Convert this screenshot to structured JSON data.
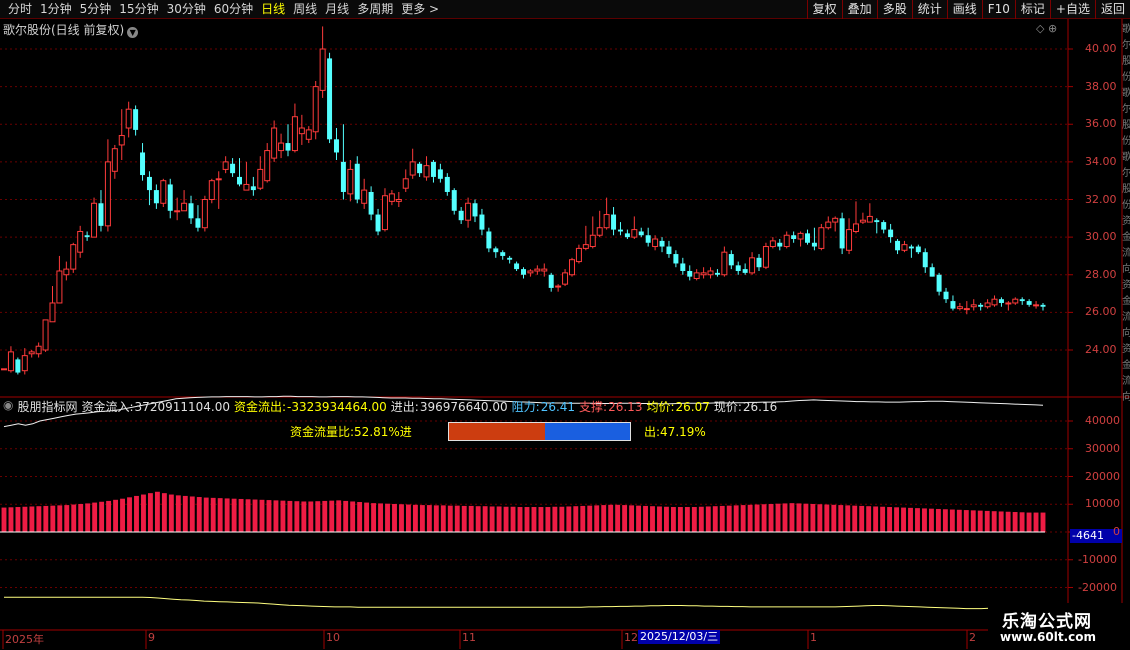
{
  "toolbar": {
    "periods": [
      "分时",
      "1分钟",
      "5分钟",
      "15分钟",
      "30分钟",
      "60分钟",
      "日线",
      "周线",
      "月线",
      "多周期",
      "更多 >"
    ],
    "active_period": "日线",
    "tools": [
      "复权",
      "叠加",
      "多股",
      "统计",
      "画线",
      "F10",
      "标记",
      "+自选",
      "返回"
    ]
  },
  "main_panel": {
    "title": "歌尔股份(日线 前复权)",
    "y_ticks": [
      "40.00",
      "38.00",
      "36.00",
      "34.00",
      "32.00",
      "30.00",
      "28.00",
      "26.00",
      "24.00"
    ]
  },
  "indicator_panel": {
    "name": "股朋指标网",
    "fields": [
      {
        "label": "资金流入:",
        "value": "3720911104.00",
        "color": "white"
      },
      {
        "label": "资金流出:",
        "value": "-3323934464.00",
        "color": "yellow"
      },
      {
        "label": "进出:",
        "value": "396976640.00",
        "color": "white"
      },
      {
        "label": "阻力:",
        "value": "26.41",
        "color": "cyan"
      },
      {
        "label": "支撑:",
        "value": "26.13",
        "color": "red"
      },
      {
        "label": "均价:",
        "value": "26.07",
        "color": "yellow"
      },
      {
        "label": "现价:",
        "value": "26.16",
        "color": "white"
      }
    ],
    "ratio_in_text": "资金流量比:52.81%进",
    "ratio_out_text": "出:47.19%",
    "ratio_in_pct": 52.81,
    "ratio_out_pct": 47.19,
    "y_ticks": [
      "40000",
      "30000",
      "20000",
      "10000",
      "0",
      "-10000",
      "-20000"
    ],
    "current_value": "-4641"
  },
  "x_axis": {
    "labels": [
      "2025年",
      "9",
      "10",
      "11",
      "12",
      "1",
      "2"
    ],
    "cursor_date": "2025/12/03/三"
  },
  "watermark": {
    "title": "乐淘公式网",
    "url": "www.60lt.com"
  },
  "right_strip_text": "歌尔股份歌尔股份歌尔股份资金流向资金流向资金流向技术指标",
  "colors": {
    "up": "#ff3b3b",
    "down": "#54ffff",
    "frame": "#a00000",
    "yellow_line": "#ffff80",
    "histogram": "#ee1c44"
  },
  "chart_data": {
    "type": "candlestick",
    "x": [
      "2025-08",
      "2025-09",
      "2025-10",
      "2025-11",
      "2025-12",
      "2026-01",
      "2026-02"
    ],
    "ylim": [
      22.6,
      41.2
    ],
    "candles": [
      [
        23.0,
        23.0,
        22.9,
        22.9
      ],
      [
        22.9,
        23.9,
        24.2,
        22.8
      ],
      [
        23.5,
        22.8,
        23.6,
        22.7
      ],
      [
        22.9,
        23.7,
        24.1,
        22.7
      ],
      [
        23.8,
        23.9,
        24.0,
        23.6
      ],
      [
        23.8,
        24.2,
        24.4,
        23.6
      ],
      [
        24.0,
        25.6,
        25.6,
        23.9
      ],
      [
        25.5,
        26.5,
        27.4,
        25.5
      ],
      [
        26.5,
        28.2,
        29.0,
        26.5
      ],
      [
        28.0,
        28.3,
        28.7,
        27.7
      ],
      [
        28.3,
        29.6,
        29.7,
        28.1
      ],
      [
        29.2,
        30.3,
        30.6,
        28.9
      ],
      [
        30.1,
        30.0,
        30.3,
        29.8
      ],
      [
        30.0,
        31.8,
        32.1,
        30.0
      ],
      [
        31.8,
        30.6,
        32.5,
        30.3
      ],
      [
        30.6,
        34.0,
        35.2,
        30.3
      ],
      [
        33.5,
        34.7,
        34.9,
        33.1
      ],
      [
        34.9,
        35.4,
        36.8,
        34.1
      ],
      [
        35.8,
        36.8,
        37.2,
        35.3
      ],
      [
        36.8,
        35.7,
        37.0,
        35.4
      ],
      [
        34.5,
        33.3,
        35.0,
        33.0
      ],
      [
        33.2,
        32.5,
        33.5,
        31.7
      ],
      [
        32.5,
        31.8,
        32.8,
        31.5
      ],
      [
        31.8,
        33.0,
        33.1,
        31.6
      ],
      [
        32.8,
        31.4,
        33.1,
        31.0
      ],
      [
        31.4,
        31.4,
        32.1,
        30.9
      ],
      [
        31.4,
        31.8,
        32.5,
        31.4
      ],
      [
        31.8,
        31.0,
        32.2,
        30.7
      ],
      [
        31.0,
        30.5,
        31.7,
        30.3
      ],
      [
        30.5,
        32.0,
        32.2,
        30.3
      ],
      [
        32.0,
        33.0,
        33.1,
        31.8
      ],
      [
        33.1,
        33.1,
        33.5,
        31.5
      ],
      [
        33.6,
        34.0,
        34.3,
        33.4
      ],
      [
        33.9,
        33.4,
        34.2,
        33.2
      ],
      [
        33.2,
        32.8,
        34.2,
        32.7
      ],
      [
        32.5,
        32.8,
        34.0,
        32.5
      ],
      [
        32.7,
        32.5,
        33.2,
        32.2
      ],
      [
        32.6,
        33.6,
        34.3,
        32.5
      ],
      [
        33.0,
        34.6,
        35.0,
        32.9
      ],
      [
        34.2,
        35.8,
        36.2,
        34.0
      ],
      [
        34.6,
        35.0,
        35.5,
        34.2
      ],
      [
        35.0,
        34.6,
        36.0,
        34.3
      ],
      [
        34.6,
        36.4,
        37.1,
        34.5
      ],
      [
        35.5,
        35.8,
        36.5,
        34.9
      ],
      [
        35.2,
        35.7,
        35.9,
        35.0
      ],
      [
        35.6,
        38.0,
        38.3,
        35.2
      ],
      [
        37.8,
        40.0,
        41.2,
        37.4
      ],
      [
        39.5,
        35.2,
        39.8,
        35.0
      ],
      [
        35.2,
        34.5,
        35.8,
        34.1
      ],
      [
        34.0,
        32.4,
        36.0,
        32.0
      ],
      [
        32.3,
        33.6,
        34.1,
        31.9
      ],
      [
        33.9,
        32.0,
        34.3,
        31.8
      ],
      [
        31.8,
        32.5,
        33.1,
        31.5
      ],
      [
        32.4,
        31.2,
        32.7,
        30.9
      ],
      [
        31.2,
        30.3,
        31.5,
        30.1
      ],
      [
        30.4,
        32.2,
        32.6,
        30.3
      ],
      [
        31.9,
        32.3,
        32.5,
        31.7
      ],
      [
        31.9,
        32.0,
        32.4,
        31.6
      ],
      [
        32.6,
        33.1,
        33.6,
        32.4
      ],
      [
        33.3,
        34.0,
        34.7,
        33.1
      ],
      [
        33.9,
        33.4,
        34.0,
        33.2
      ],
      [
        33.2,
        33.8,
        34.3,
        33.0
      ],
      [
        34.0,
        33.2,
        34.1,
        32.9
      ],
      [
        33.6,
        33.1,
        33.9,
        32.9
      ],
      [
        33.2,
        32.4,
        33.4,
        32.2
      ],
      [
        32.5,
        31.4,
        32.6,
        31.2
      ],
      [
        31.4,
        30.9,
        31.6,
        30.7
      ],
      [
        30.9,
        31.8,
        32.1,
        30.5
      ],
      [
        31.8,
        31.1,
        32.0,
        30.8
      ],
      [
        31.2,
        30.4,
        31.5,
        30.1
      ],
      [
        30.3,
        29.4,
        30.5,
        29.2
      ],
      [
        29.4,
        29.2,
        29.5,
        28.9
      ],
      [
        29.2,
        29.0,
        29.3,
        28.8
      ],
      [
        28.9,
        28.8,
        29.0,
        28.6
      ],
      [
        28.6,
        28.3,
        28.7,
        28.2
      ],
      [
        28.3,
        28.0,
        28.4,
        27.8
      ],
      [
        28.1,
        28.2,
        28.3,
        27.9
      ],
      [
        28.2,
        28.3,
        28.5,
        28.0
      ],
      [
        28.2,
        28.3,
        28.6,
        27.9
      ],
      [
        28.0,
        27.3,
        28.1,
        27.1
      ],
      [
        27.4,
        27.4,
        27.5,
        27.1
      ],
      [
        27.5,
        28.1,
        28.3,
        27.4
      ],
      [
        28.0,
        28.8,
        28.9,
        27.9
      ],
      [
        28.7,
        29.4,
        29.6,
        28.6
      ],
      [
        29.4,
        29.6,
        30.6,
        29.3
      ],
      [
        29.5,
        30.1,
        31.1,
        29.4
      ],
      [
        30.1,
        30.5,
        31.4,
        30.0
      ],
      [
        30.5,
        31.2,
        32.1,
        30.4
      ],
      [
        31.2,
        30.4,
        31.6,
        30.1
      ],
      [
        30.4,
        30.3,
        30.8,
        30.1
      ],
      [
        30.2,
        30.0,
        30.4,
        29.9
      ],
      [
        30.0,
        30.4,
        31.1,
        29.9
      ],
      [
        30.3,
        30.1,
        30.5,
        30.0
      ],
      [
        30.1,
        29.7,
        30.5,
        29.5
      ],
      [
        29.5,
        29.9,
        30.1,
        29.3
      ],
      [
        29.8,
        29.5,
        30.0,
        29.2
      ],
      [
        29.5,
        29.1,
        29.8,
        28.9
      ],
      [
        29.1,
        28.6,
        29.3,
        28.4
      ],
      [
        28.6,
        28.2,
        28.9,
        28.0
      ],
      [
        28.2,
        27.9,
        28.5,
        27.7
      ],
      [
        27.8,
        28.1,
        28.3,
        27.7
      ],
      [
        28.0,
        28.1,
        28.4,
        27.8
      ],
      [
        28.0,
        28.2,
        28.4,
        27.8
      ],
      [
        28.1,
        28.0,
        28.3,
        27.9
      ],
      [
        28.0,
        29.2,
        29.5,
        27.9
      ],
      [
        29.1,
        28.5,
        29.3,
        28.3
      ],
      [
        28.5,
        28.2,
        28.7,
        28.0
      ],
      [
        28.3,
        28.1,
        28.6,
        28.0
      ],
      [
        28.1,
        28.9,
        29.2,
        28.0
      ],
      [
        28.9,
        28.4,
        29.1,
        28.2
      ],
      [
        28.4,
        29.5,
        29.7,
        28.3
      ],
      [
        29.5,
        29.8,
        30.0,
        29.4
      ],
      [
        29.7,
        29.5,
        29.9,
        29.3
      ],
      [
        29.5,
        30.1,
        30.3,
        29.4
      ],
      [
        30.1,
        29.9,
        30.3,
        29.7
      ],
      [
        29.9,
        30.2,
        30.3,
        29.5
      ],
      [
        30.2,
        29.7,
        30.4,
        29.6
      ],
      [
        29.7,
        29.5,
        30.5,
        29.3
      ],
      [
        29.4,
        30.5,
        30.7,
        29.3
      ],
      [
        30.5,
        30.8,
        31.1,
        30.4
      ],
      [
        30.8,
        31.0,
        31.1,
        30.3
      ],
      [
        31.0,
        29.4,
        31.3,
        29.1
      ],
      [
        29.3,
        30.4,
        31.0,
        29.1
      ],
      [
        30.3,
        30.7,
        31.9,
        30.2
      ],
      [
        30.8,
        30.9,
        31.3,
        30.7
      ],
      [
        30.8,
        31.1,
        31.8,
        30.8
      ],
      [
        30.9,
        30.8,
        31.0,
        30.2
      ],
      [
        30.8,
        30.4,
        30.9,
        30.2
      ],
      [
        30.4,
        30.0,
        30.7,
        29.7
      ],
      [
        29.8,
        29.3,
        29.9,
        29.1
      ],
      [
        29.3,
        29.6,
        29.8,
        29.2
      ],
      [
        29.5,
        29.4,
        29.6,
        28.9
      ],
      [
        29.5,
        29.2,
        29.6,
        29.1
      ],
      [
        29.2,
        28.4,
        29.4,
        28.1
      ],
      [
        28.4,
        27.9,
        28.6,
        27.9
      ],
      [
        28.0,
        27.1,
        28.1,
        26.9
      ],
      [
        27.1,
        26.7,
        27.3,
        26.5
      ],
      [
        26.6,
        26.2,
        26.9,
        26.1
      ],
      [
        26.2,
        26.3,
        26.5,
        26.1
      ],
      [
        26.2,
        26.2,
        26.6,
        25.9
      ],
      [
        26.3,
        26.4,
        26.7,
        26.1
      ],
      [
        26.4,
        26.3,
        26.5,
        26.1
      ],
      [
        26.3,
        26.5,
        26.7,
        26.2
      ],
      [
        26.4,
        26.7,
        26.9,
        26.3
      ],
      [
        26.7,
        26.5,
        26.8,
        26.3
      ],
      [
        26.5,
        26.5,
        26.6,
        26.1
      ],
      [
        26.5,
        26.7,
        26.8,
        26.4
      ],
      [
        26.7,
        26.6,
        26.8,
        26.4
      ],
      [
        26.6,
        26.4,
        26.7,
        26.3
      ],
      [
        26.4,
        26.4,
        26.6,
        26.2
      ],
      [
        26.4,
        26.3,
        26.5,
        26.1
      ]
    ],
    "indicator": {
      "white_line": [
        38000,
        38500,
        39000,
        38500,
        39000,
        40000,
        40500,
        41000,
        41500,
        42000,
        42500,
        42700,
        43000,
        43300,
        43500,
        43700,
        44000,
        44500,
        45000,
        45500,
        46000,
        46500,
        47000,
        47500,
        48000,
        48200,
        48400,
        48500,
        48600,
        48700,
        48700,
        48800,
        48800,
        48800,
        48800,
        48700,
        48700,
        48800,
        48800,
        48900,
        48900,
        48800,
        48800,
        48800,
        48700,
        48700,
        48800,
        48800,
        48800,
        48700,
        48700,
        48600,
        48500,
        48400,
        48300,
        48300,
        48300,
        48200,
        48200,
        48100,
        48000,
        48000,
        47900,
        47800,
        47700,
        47600,
        47500,
        47400,
        47300,
        47200,
        47100,
        47000,
        46900,
        46800,
        46700,
        46600,
        46500,
        46500,
        46500,
        46400,
        46400,
        46400,
        46400,
        46300,
        46300,
        46300,
        46400,
        46400,
        46400,
        46300,
        46300,
        46200,
        46200,
        46200,
        46300,
        46400,
        46400,
        46400,
        46400,
        46500,
        46500,
        46500,
        46600,
        46600,
        46700,
        46700,
        46800,
        46800,
        46900,
        47000,
        47200,
        47400,
        47500,
        47600,
        47500,
        47400,
        47300,
        47200,
        47100,
        47000,
        47000,
        46900,
        46900,
        46800,
        46800,
        46800,
        46900,
        47000,
        47000,
        47100,
        47100,
        47100,
        47000,
        46900,
        46800,
        46700,
        46600,
        46500,
        46400,
        46300,
        46200,
        46100,
        46000,
        45900,
        45800,
        45700
      ],
      "histogram": [
        8800,
        8900,
        9000,
        9100,
        9200,
        9300,
        9400,
        9500,
        9600,
        9700,
        9900,
        10100,
        10300,
        10600,
        10900,
        11200,
        11600,
        12000,
        12500,
        13000,
        13500,
        14000,
        14500,
        14000,
        13500,
        13200,
        13000,
        12800,
        12600,
        12400,
        12300,
        12200,
        12100,
        12000,
        11900,
        11800,
        11700,
        11600,
        11500,
        11400,
        11300,
        11200,
        11100,
        11000,
        11000,
        11100,
        11200,
        11300,
        11400,
        11200,
        11000,
        10800,
        10600,
        10400,
        10300,
        10200,
        10100,
        10000,
        9900,
        9800,
        9700,
        9700,
        9600,
        9600,
        9500,
        9500,
        9400,
        9400,
        9300,
        9300,
        9200,
        9200,
        9100,
        9100,
        9000,
        9000,
        9000,
        9000,
        9000,
        9100,
        9100,
        9200,
        9300,
        9400,
        9500,
        9600,
        9700,
        9800,
        9800,
        9700,
        9600,
        9500,
        9400,
        9300,
        9200,
        9100,
        9000,
        9000,
        9000,
        9000,
        9100,
        9200,
        9300,
        9400,
        9500,
        9600,
        9700,
        9800,
        9900,
        10000,
        10100,
        10200,
        10300,
        10400,
        10300,
        10200,
        10100,
        10000,
        9900,
        9800,
        9700,
        9600,
        9500,
        9400,
        9300,
        9200,
        9100,
        9000,
        8900,
        8800,
        8700,
        8600,
        8500,
        8400,
        8300,
        8200,
        8100,
        8000,
        7900,
        7800,
        7700,
        7600,
        7500,
        7400,
        7300,
        7200,
        7100,
        7000,
        7000,
        7000
      ],
      "yellow_line": [
        -23500,
        -23500,
        -23500,
        -23500,
        -23500,
        -23500,
        -23500,
        -23500,
        -23500,
        -23500,
        -23500,
        -23500,
        -23500,
        -23500,
        -23500,
        -23500,
        -23500,
        -23500,
        -23500,
        -23600,
        -23800,
        -24000,
        -24200,
        -24400,
        -24500,
        -24700,
        -24900,
        -25000,
        -25100,
        -25200,
        -25300,
        -25400,
        -25500,
        -25600,
        -25800,
        -26000,
        -26200,
        -26400,
        -26500,
        -26600,
        -26700,
        -26800,
        -26900,
        -27000,
        -27000,
        -27000,
        -27100,
        -27100,
        -27100,
        -27100,
        -27100,
        -27100,
        -27100,
        -27100,
        -27100,
        -27100,
        -27100,
        -27100,
        -27100,
        -27100,
        -27100,
        -27100,
        -27100,
        -27100,
        -27100,
        -27100,
        -27100,
        -27100,
        -27100,
        -27100,
        -27100,
        -27100,
        -27100,
        -27100,
        -27100,
        -27100,
        -27000,
        -27000,
        -26900,
        -26900,
        -26800,
        -26800,
        -26700,
        -26700,
        -26600,
        -26600,
        -26500,
        -26500,
        -26500,
        -26600,
        -26600,
        -26700,
        -26700,
        -26800,
        -26800,
        -26900,
        -26900,
        -27000,
        -27000,
        -27000,
        -27000,
        -27000,
        -27000,
        -27000,
        -27000,
        -27000,
        -27000,
        -27000,
        -27000,
        -26900,
        -26800,
        -26700,
        -26600,
        -26500,
        -26500,
        -26600,
        -26700,
        -26800,
        -26900,
        -27000,
        -27100,
        -27200,
        -27300,
        -27400,
        -27500,
        -27600,
        -27600,
        -27600,
        -27500,
        -27400,
        -27300,
        -27200,
        -27100,
        -27000,
        -26900,
        -26800
      ]
    },
    "indicator_ylim": [
      -28000,
      45000
    ]
  }
}
